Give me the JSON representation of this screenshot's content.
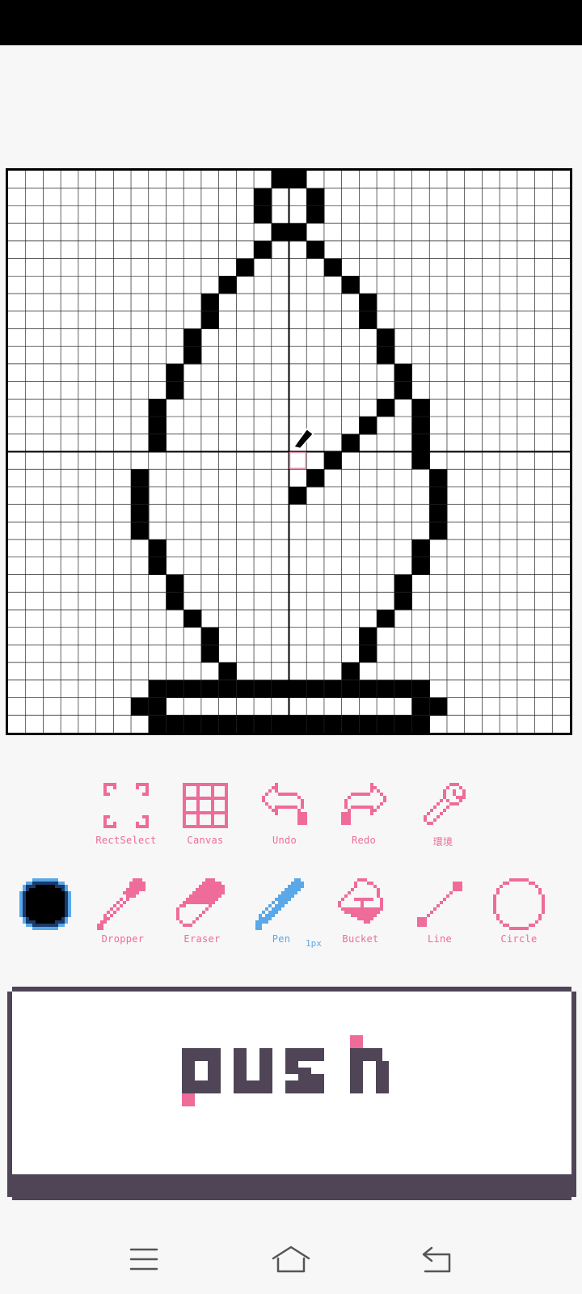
{
  "canvas": {
    "grid_size": 32,
    "background": "#ffffff",
    "pixel_color": "#000000",
    "grid_line_color": "#222222",
    "guide_color": "#000000",
    "cursor_cell_color": "#e58fb0",
    "pixels": [
      [
        15,
        0
      ],
      [
        16,
        0
      ],
      [
        14,
        1
      ],
      [
        17,
        1
      ],
      [
        14,
        2
      ],
      [
        17,
        2
      ],
      [
        15,
        3
      ],
      [
        16,
        3
      ],
      [
        14,
        4
      ],
      [
        17,
        4
      ],
      [
        13,
        5
      ],
      [
        18,
        5
      ],
      [
        12,
        6
      ],
      [
        19,
        6
      ],
      [
        11,
        7
      ],
      [
        20,
        7
      ],
      [
        11,
        8
      ],
      [
        20,
        8
      ],
      [
        10,
        9
      ],
      [
        21,
        9
      ],
      [
        10,
        10
      ],
      [
        21,
        10
      ],
      [
        9,
        11
      ],
      [
        22,
        11
      ],
      [
        9,
        12
      ],
      [
        22,
        12
      ],
      [
        8,
        13
      ],
      [
        21,
        13
      ],
      [
        23,
        13
      ],
      [
        8,
        14
      ],
      [
        20,
        14
      ],
      [
        23,
        14
      ],
      [
        8,
        15
      ],
      [
        19,
        15
      ],
      [
        23,
        15
      ],
      [
        18,
        16
      ],
      [
        23,
        16
      ],
      [
        7,
        17
      ],
      [
        17,
        17
      ],
      [
        24,
        17
      ],
      [
        7,
        18
      ],
      [
        16,
        18
      ],
      [
        24,
        18
      ],
      [
        7,
        19
      ],
      [
        24,
        19
      ],
      [
        7,
        20
      ],
      [
        24,
        20
      ],
      [
        8,
        21
      ],
      [
        23,
        21
      ],
      [
        8,
        22
      ],
      [
        23,
        22
      ],
      [
        9,
        23
      ],
      [
        22,
        23
      ],
      [
        9,
        24
      ],
      [
        22,
        24
      ],
      [
        10,
        25
      ],
      [
        21,
        25
      ],
      [
        11,
        26
      ],
      [
        20,
        26
      ],
      [
        11,
        27
      ],
      [
        20,
        27
      ],
      [
        12,
        28
      ],
      [
        19,
        28
      ],
      [
        8,
        29
      ],
      [
        9,
        29
      ],
      [
        10,
        29
      ],
      [
        11,
        29
      ],
      [
        12,
        29
      ],
      [
        13,
        29
      ],
      [
        14,
        29
      ],
      [
        15,
        29
      ],
      [
        16,
        29
      ],
      [
        17,
        29
      ],
      [
        18,
        29
      ],
      [
        19,
        29
      ],
      [
        20,
        29
      ],
      [
        21,
        29
      ],
      [
        22,
        29
      ],
      [
        23,
        29
      ],
      [
        7,
        30
      ],
      [
        8,
        30
      ],
      [
        23,
        30
      ],
      [
        24,
        30
      ],
      [
        8,
        31
      ],
      [
        9,
        31
      ],
      [
        10,
        31
      ],
      [
        11,
        31
      ],
      [
        12,
        31
      ],
      [
        13,
        31
      ],
      [
        14,
        31
      ],
      [
        15,
        31
      ],
      [
        16,
        31
      ],
      [
        17,
        31
      ],
      [
        18,
        31
      ],
      [
        19,
        31
      ],
      [
        20,
        31
      ],
      [
        21,
        31
      ],
      [
        22,
        31
      ],
      [
        23,
        31
      ]
    ],
    "cursor_cell": [
      16,
      16
    ],
    "guide_cell": [
      16,
      16
    ]
  },
  "current_color": "#000000",
  "accent_color": "#ef6b9a",
  "active_color": "#5aa8e8",
  "toolbar_top": [
    {
      "label": "RectSelect",
      "icon": "rect-select-icon"
    },
    {
      "label": "Canvas",
      "icon": "grid-icon"
    },
    {
      "label": "Undo",
      "icon": "undo-icon"
    },
    {
      "label": "Redo",
      "icon": "redo-icon"
    },
    {
      "label": "環境",
      "icon": "wrench-icon"
    }
  ],
  "toolbar_bottom": [
    {
      "label": "Dropper",
      "icon": "dropper-icon"
    },
    {
      "label": "Eraser",
      "icon": "eraser-icon"
    },
    {
      "label": "Pen",
      "icon": "pen-icon",
      "active": true
    },
    {
      "label": "Bucket",
      "icon": "bucket-icon"
    },
    {
      "label": "Line",
      "icon": "line-icon"
    },
    {
      "label": "Circle",
      "icon": "circle-icon"
    }
  ],
  "pen_size": "1px",
  "push_button": {
    "label": "push",
    "text_color": "#4f4557",
    "accent": "#ef6b9a"
  },
  "nav": {
    "menu": "menu-icon",
    "home": "home-icon",
    "back": "back-icon"
  }
}
